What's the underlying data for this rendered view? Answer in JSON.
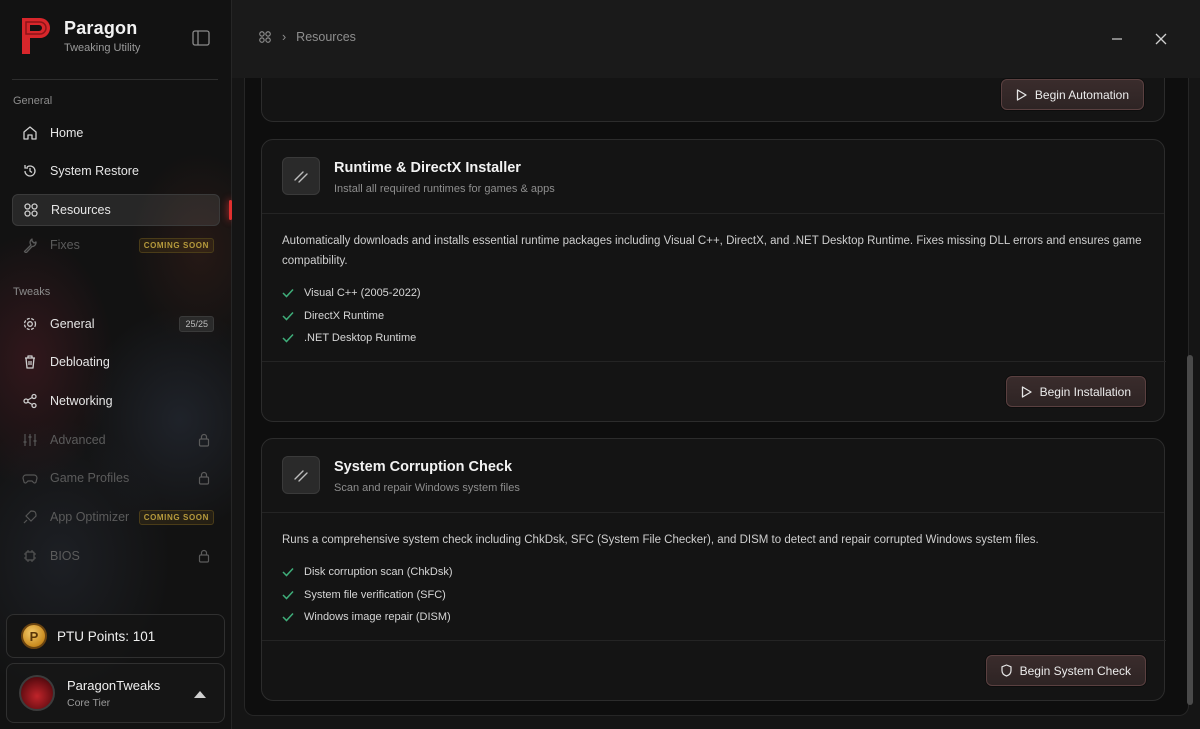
{
  "brand": {
    "name": "Paragon",
    "subtitle": "Tweaking Utility",
    "accent": "#d8262b"
  },
  "sidebar": {
    "general_label": "General",
    "tweaks_label": "Tweaks",
    "general_items": [
      {
        "label": "Home",
        "icon": "home-icon"
      },
      {
        "label": "System Restore",
        "icon": "restore-icon"
      },
      {
        "label": "Resources",
        "icon": "grid-icon",
        "active": true
      },
      {
        "label": "Fixes",
        "icon": "wrench-icon",
        "badge": "COMING SOON",
        "disabled": true
      }
    ],
    "tweak_items": [
      {
        "label": "General",
        "icon": "gear-icon",
        "count": "25/25"
      },
      {
        "label": "Debloating",
        "icon": "trash-icon"
      },
      {
        "label": "Networking",
        "icon": "share-icon"
      },
      {
        "label": "Advanced",
        "icon": "sliders-icon",
        "locked": true,
        "disabled": true
      },
      {
        "label": "Game Profiles",
        "icon": "gamepad-icon",
        "locked": true,
        "disabled": true
      },
      {
        "label": "App Optimizer",
        "icon": "rocket-icon",
        "badge": "COMING SOON",
        "disabled": true
      },
      {
        "label": "BIOS",
        "icon": "chip-icon",
        "locked": true,
        "disabled": true
      }
    ],
    "points": {
      "label": "PTU Points: 101",
      "coin": "P"
    },
    "user": {
      "name": "ParagonTweaks",
      "tier": "Core Tier"
    }
  },
  "header": {
    "breadcrumb": "Resources"
  },
  "cards": {
    "automation": {
      "button": "Begin Automation"
    },
    "runtime": {
      "title": "Runtime & DirectX Installer",
      "subtitle": "Install all required runtimes for games & apps",
      "description": "Automatically downloads and installs essential runtime packages including Visual C++, DirectX, and .NET Desktop Runtime. Fixes missing DLL errors and ensures game compatibility.",
      "checks": [
        "Visual C++ (2005-2022)",
        "DirectX Runtime",
        ".NET Desktop Runtime"
      ],
      "button": "Begin Installation"
    },
    "corruption": {
      "title": "System Corruption Check",
      "subtitle": "Scan and repair Windows system files",
      "description": "Runs a comprehensive system check including ChkDsk, SFC (System File Checker), and DISM to detect and repair corrupted Windows system files.",
      "checks": [
        "Disk corruption scan (ChkDsk)",
        "System file verification (SFC)",
        "Windows image repair (DISM)"
      ],
      "button": "Begin System Check"
    }
  },
  "colors": {
    "check": "#3fae7a",
    "active_marker": "#e0302f",
    "badge_soon": "#b69a3c"
  }
}
